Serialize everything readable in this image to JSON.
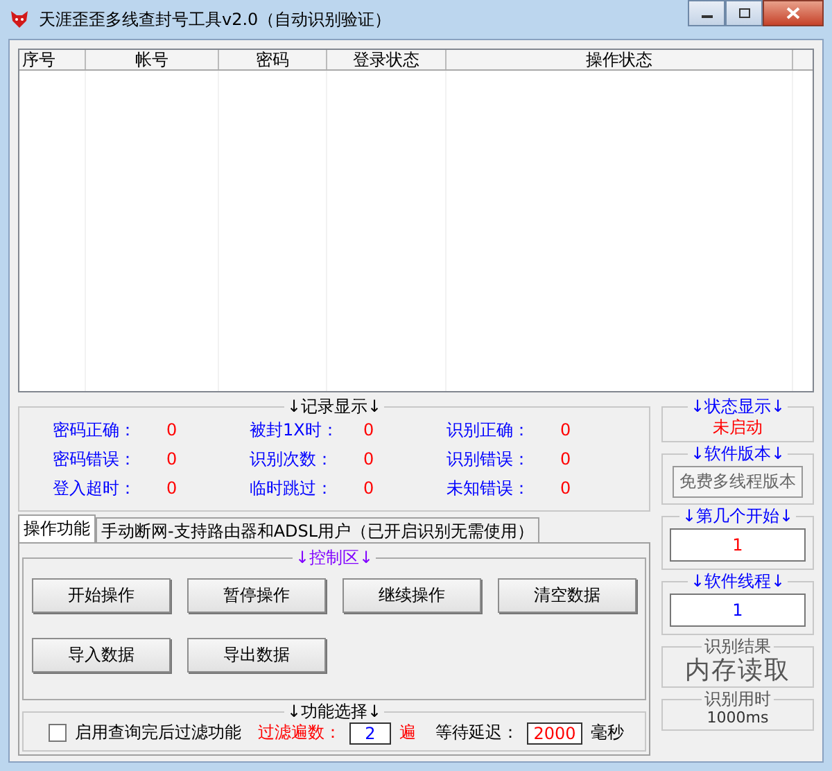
{
  "window": {
    "title": "天涯歪歪多线查封号工具v2.0（自动识别验证）"
  },
  "table": {
    "columns": [
      "序号",
      "帐号",
      "密码",
      "登录状态",
      "操作状态"
    ]
  },
  "records": {
    "title": "↓记录显示↓",
    "items": [
      {
        "label": "密码正确：",
        "value": "0"
      },
      {
        "label": "被封1X时：",
        "value": "0"
      },
      {
        "label": "识别正确：",
        "value": "0"
      },
      {
        "label": "密码错误：",
        "value": "0"
      },
      {
        "label": "识别次数：",
        "value": "0"
      },
      {
        "label": "识别错误：",
        "value": "0"
      },
      {
        "label": "登入超时：",
        "value": "0"
      },
      {
        "label": "临时跳过：",
        "value": "0"
      },
      {
        "label": "未知错误：",
        "value": "0"
      }
    ]
  },
  "side_panels": [
    {
      "kind": "status",
      "title": "↓状态显示↓",
      "value": "未启动"
    },
    {
      "kind": "button",
      "title": "↓软件版本↓",
      "value": "免费多线程版本"
    },
    {
      "kind": "field",
      "title": "↓第几个开始↓",
      "value": "1",
      "color": "#ff0000"
    },
    {
      "kind": "field",
      "title": "↓软件线程↓",
      "value": "1",
      "color": "#0000ff"
    },
    {
      "kind": "big",
      "title": "识别结果",
      "value": "内存读取"
    },
    {
      "kind": "small",
      "title": "识别用时",
      "value": "1000ms"
    }
  ],
  "tabs": [
    {
      "label": "操作功能",
      "selected": true
    },
    {
      "label": "手动断网-支持路由器和ADSL用户（已开启识别无需使用）",
      "selected": false
    }
  ],
  "control": {
    "title": "↓控制区↓",
    "buttons": [
      "开始操作",
      "暂停操作",
      "继续操作",
      "清空数据",
      "导入数据",
      "导出数据"
    ]
  },
  "options": {
    "title": "↓功能选择↓",
    "filter": {
      "label": "启用查询完后过滤功能",
      "checked": false
    },
    "passes_label": "过滤遍数：",
    "passes": "2",
    "passes_unit": "遍",
    "delay_label": "等待延迟：",
    "delay": "2000",
    "delay_unit": "毫秒"
  }
}
